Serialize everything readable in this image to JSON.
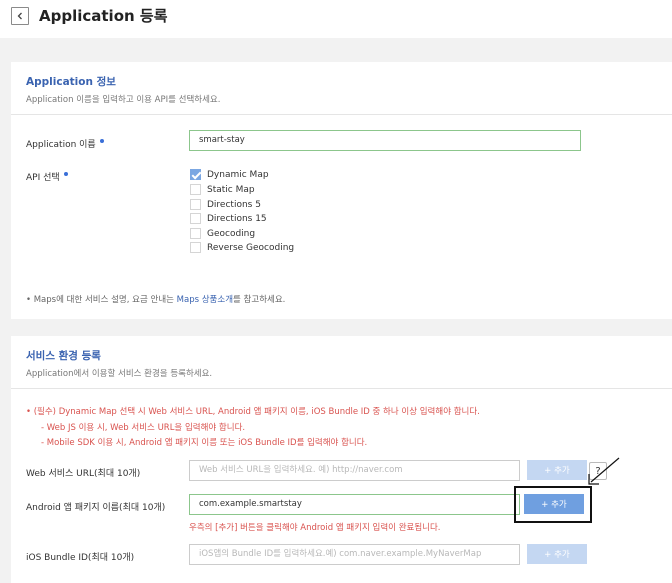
{
  "header": {
    "title": "Application 등록"
  },
  "app_info": {
    "title": "Application 정보",
    "desc": "Application 이름을 입력하고 이용 API를 선택하세요.",
    "name_label": "Application 이름",
    "name_value": "smart-stay",
    "api_label": "API 선택",
    "apis": [
      {
        "label": "Dynamic Map",
        "checked": true
      },
      {
        "label": "Static Map",
        "checked": false
      },
      {
        "label": "Directions 5",
        "checked": false
      },
      {
        "label": "Directions 15",
        "checked": false
      },
      {
        "label": "Geocoding",
        "checked": false
      },
      {
        "label": "Reverse Geocoding",
        "checked": false
      }
    ],
    "note_prefix": "•  Maps에 대한 서비스 설명, 요금 안내는 ",
    "note_link": "Maps 상품소개",
    "note_suffix": "를 참고하세요."
  },
  "service_env": {
    "title": "서비스 환경 등록",
    "desc": "Application에서 이용할 서비스 환경을 등록하세요.",
    "warnings": [
      "•  (필수) Dynamic Map 선택 시 Web 서비스 URL, Android 앱 패키지 이름, iOS Bundle ID 중 하나 이상 입력해야 합니다.",
      "- Web JS 이용 시, Web 서비스 URL을 입력해야 합니다.",
      "- Mobile SDK 이용 시, Android 앱 패키지 이름 또는 iOS Bundle ID를 입력해야 합니다."
    ],
    "web_label": "Web 서비스 URL(최대 10개)",
    "web_placeholder": "Web 서비스 URL을 입력하세요. 예) http://naver.com",
    "android_label": "Android 앱 패키지 이름(최대 10개)",
    "android_value": "com.example.smartstay",
    "android_hint": "우측의 [추가] 버튼을 클릭해야 Android 앱 패키지 입력이 완료됩니다.",
    "ios_label": "iOS Bundle ID(최대 10개)",
    "ios_placeholder": "iOS앱의 Bundle ID를 입력하세요.예) com.naver.example.MyNaverMap",
    "add_label": "+ 추가",
    "help_label": "?"
  }
}
